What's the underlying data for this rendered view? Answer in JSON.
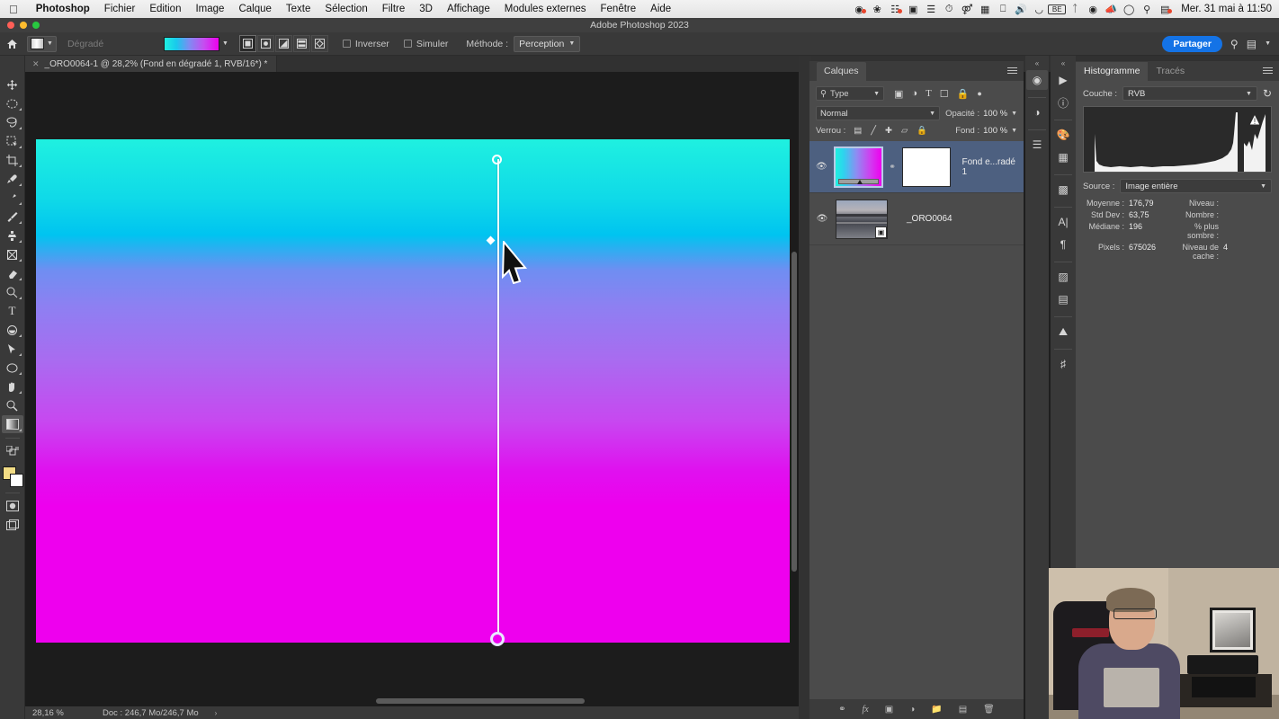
{
  "macmenu": {
    "apple": "apple-logo",
    "items": [
      "Photoshop",
      "Fichier",
      "Edition",
      "Image",
      "Calque",
      "Texte",
      "Sélection",
      "Filtre",
      "3D",
      "Affichage",
      "Modules externes",
      "Fenêtre",
      "Aide"
    ],
    "status_icons": [
      "screen-record-icon",
      "butterfly-icon",
      "tasks-icon",
      "camera-icon",
      "clipboard-icon",
      "clock-icon",
      "binoculars-icon",
      "split-view-icon",
      "display-icon",
      "volume-icon",
      "headphones-icon",
      "be-icon",
      "bluetooth-icon",
      "location-icon",
      "megaphone-icon",
      "wifi-icon",
      "search-icon",
      "control-center-icon"
    ],
    "clock": "Mer. 31 mai à 11:50"
  },
  "window": {
    "title": "Adobe Photoshop 2023"
  },
  "options_bar": {
    "home_icon": "home-icon",
    "tool_preset_label": "gradient-preset",
    "gradient_label": "Dégradé",
    "gradient_swatch": "cyan-to-magenta",
    "gradient_types": [
      {
        "name": "linear-gradient",
        "selected": true
      },
      {
        "name": "radial-gradient",
        "selected": false
      },
      {
        "name": "angle-gradient",
        "selected": false
      },
      {
        "name": "reflected-gradient",
        "selected": false
      },
      {
        "name": "diamond-gradient",
        "selected": false
      }
    ],
    "invert_label": "Inverser",
    "invert_checked": false,
    "dither_label": "Simuler",
    "dither_checked": false,
    "method_label": "Méthode :",
    "method_value": "Perception",
    "share_label": "Partager",
    "search_icon": "search-icon",
    "workspace_icon": "workspace-icon"
  },
  "document": {
    "tab_title": "_ORO0064-1 @ 28,2% (Fond en dégradé 1, RVB/16*) *",
    "close_icon": "close-icon"
  },
  "toolbar": {
    "tools": [
      {
        "name": "move-tool",
        "glyph": "✥",
        "selected": false
      },
      {
        "name": "marquee-tool",
        "glyph": "◯",
        "selected": false
      },
      {
        "name": "lasso-tool",
        "glyph": "◗",
        "selected": false
      },
      {
        "name": "object-selection-tool",
        "glyph": "▧",
        "selected": false
      },
      {
        "name": "crop-tool",
        "glyph": "✂",
        "selected": false
      },
      {
        "name": "eyedropper-tool",
        "glyph": "✎",
        "selected": false
      },
      {
        "name": "healing-brush-tool",
        "glyph": "✒",
        "selected": false
      },
      {
        "name": "brush-tool",
        "glyph": "🖌",
        "selected": false
      },
      {
        "name": "clone-stamp-tool",
        "glyph": "⛟",
        "selected": false
      },
      {
        "name": "history-brush-tool",
        "glyph": "⧗",
        "selected": false
      },
      {
        "name": "eraser-tool",
        "glyph": "◣",
        "selected": false
      },
      {
        "name": "gradient-tool",
        "glyph": "◧",
        "selected": false
      },
      {
        "name": "blur-tool",
        "glyph": "◐",
        "selected": false
      },
      {
        "name": "dodge-tool",
        "glyph": "⊙",
        "selected": false
      },
      {
        "name": "pen-tool",
        "glyph": "✑",
        "selected": false
      },
      {
        "name": "type-tool",
        "glyph": "T",
        "selected": false
      },
      {
        "name": "path-selection-tool",
        "glyph": "➤",
        "selected": false
      },
      {
        "name": "shape-tool",
        "glyph": "▭",
        "selected": false
      },
      {
        "name": "hand-tool",
        "glyph": "✋",
        "selected": false
      },
      {
        "name": "zoom-tool",
        "glyph": "🔍",
        "selected": false
      },
      {
        "name": "gradient-tool-active",
        "glyph": "▤",
        "selected": true
      }
    ],
    "foreground_color": "#f2dc85",
    "background_color": "#ffffff",
    "quick_mask_icon": "quick-mask-icon",
    "screen_mode_icon": "screen-mode-icon"
  },
  "canvas": {
    "gradient_start_color": "#1ff0e0",
    "gradient_end_color": "#ee00ee",
    "widget": {
      "start_handle": "gradient-start-handle",
      "midpoint_handle": "gradient-midpoint-handle",
      "end_handle": "gradient-end-handle"
    },
    "cursor": "arrow-cursor"
  },
  "status_bar": {
    "zoom": "28,16 %",
    "doc_info": "Doc : 246,7 Mo/246,7 Mo",
    "arrow": "›"
  },
  "layers_panel": {
    "title": "Calques",
    "menu_icon": "panel-menu-icon",
    "filter_label": "Type",
    "filter_icons": [
      "pixel-filter-icon",
      "adjustment-filter-icon",
      "type-filter-icon",
      "shape-filter-icon",
      "smart-object-filter-icon",
      "filter-toggle-icon"
    ],
    "blend_mode": "Normal",
    "opacity_label": "Opacité :",
    "opacity_value": "100 %",
    "lock_label": "Verrou :",
    "lock_icons": [
      "lock-transparent-icon",
      "lock-image-icon",
      "lock-position-icon",
      "lock-artboard-icon",
      "lock-all-icon"
    ],
    "fill_label": "Fond :",
    "fill_value": "100 %",
    "layers": [
      {
        "name": "Fond e...radé 1",
        "visible": true,
        "selected": true,
        "thumb_type": "gradient",
        "has_mask": true,
        "link_icon": "link-icon"
      },
      {
        "name": "_ORO0064",
        "visible": true,
        "selected": false,
        "thumb_type": "photo",
        "has_mask": false,
        "badge": "smart-object-badge"
      }
    ],
    "footer_icons": [
      "link-layers-icon",
      "layer-style-fx-icon",
      "add-mask-icon",
      "adjustment-layer-icon",
      "new-group-icon",
      "new-layer-icon",
      "delete-layer-icon"
    ]
  },
  "rails": {
    "left": [
      "color-wheel-icon",
      "adjustments-icon",
      "sliders-icon"
    ],
    "right": [
      "libraries-play-icon",
      "info-icon",
      "swatches-icon",
      "patterns-grid-icon",
      "actions-icon",
      "character-icon",
      "paragraph-icon",
      "properties-icon",
      "notes-icon",
      "gradients-icon",
      "styles-icon"
    ],
    "collapse_icon": "collapse-panels-icon"
  },
  "histogram_panel": {
    "tabs": [
      {
        "label": "Histogramme",
        "selected": true
      },
      {
        "label": "Tracés",
        "selected": false
      }
    ],
    "menu_icon": "panel-menu-icon",
    "channel_label": "Couche :",
    "channel_value": "RVB",
    "refresh_icon": "refresh-icon",
    "source_label": "Source :",
    "source_value": "Image entière",
    "warning_icon": "uncached-warning-icon",
    "stats": [
      {
        "label": "Moyenne :",
        "value": "176,79"
      },
      {
        "label": "Niveau :",
        "value": ""
      },
      {
        "label": "Std Dev :",
        "value": "63,75"
      },
      {
        "label": "Nombre :",
        "value": ""
      },
      {
        "label": "Médiane :",
        "value": "196"
      },
      {
        "label": "% plus sombre :",
        "value": ""
      },
      {
        "label": "Pixels :",
        "value": "675026"
      },
      {
        "label": "Niveau de cache :",
        "value": "4"
      }
    ]
  },
  "webcam": {
    "label": "webcam-overlay"
  }
}
